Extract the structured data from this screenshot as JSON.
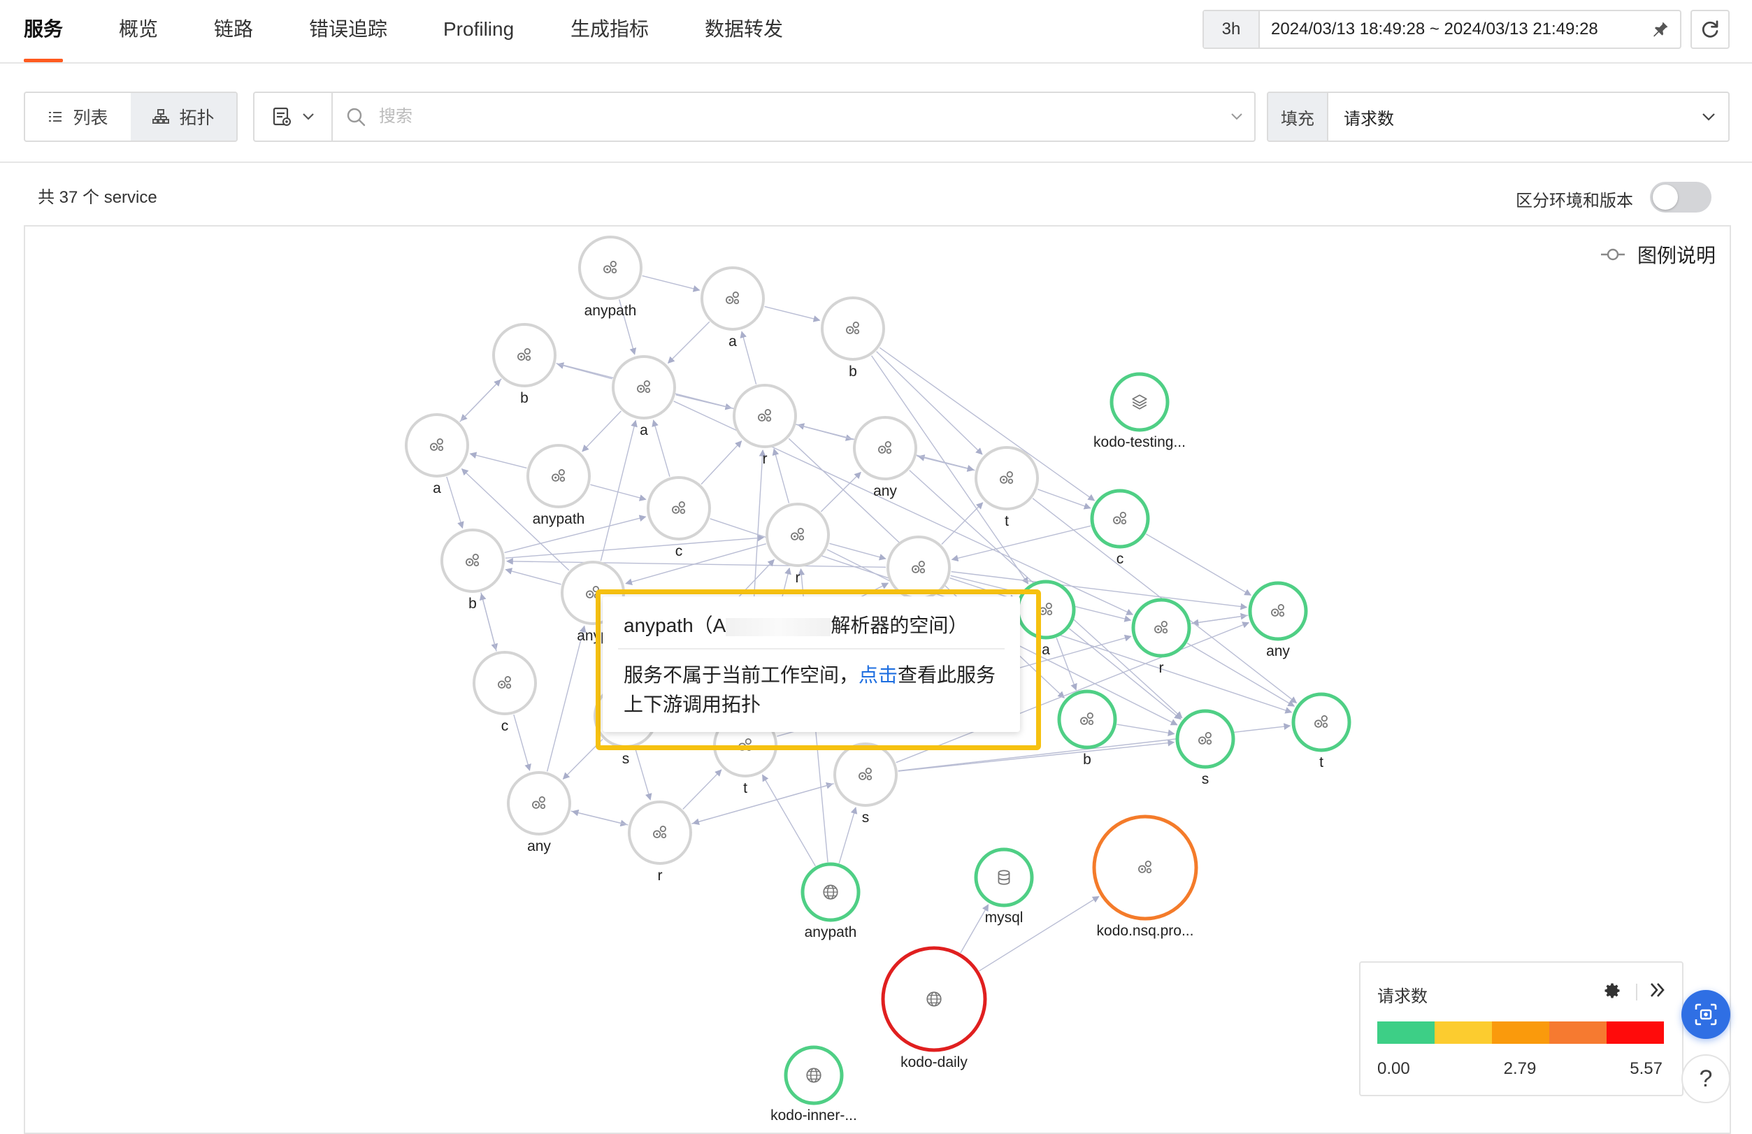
{
  "nav": {
    "tabs": [
      {
        "label": "服务",
        "active": true
      },
      {
        "label": "概览"
      },
      {
        "label": "链路"
      },
      {
        "label": "错误追踪"
      },
      {
        "label": "Profiling"
      },
      {
        "label": "生成指标"
      },
      {
        "label": "数据转发"
      }
    ],
    "time_range_label": "3h",
    "time_range_text": "2024/03/13 18:49:28 ~ 2024/03/13 21:49:28",
    "pin_icon": "pin-icon",
    "refresh_icon": "refresh-icon"
  },
  "toolbar": {
    "view_list_label": "列表",
    "view_topology_label": "拓扑",
    "active_view": "拓扑",
    "search_placeholder": "搜索",
    "fill_label": "填充",
    "fill_value": "请求数"
  },
  "summary": {
    "service_count_text": "共 37 个 service",
    "env_version_label": "区分环境和版本",
    "env_version_enabled": false
  },
  "legend_toggle_label": "图例说明",
  "colors": {
    "normal_stroke": "#d4d4d4",
    "healthy_stroke": "#4fcf85",
    "warning_stroke": "#f47b2a",
    "error_stroke": "#e01f1f",
    "edge": "#b9bdd4",
    "highlight": "#f6c110",
    "link": "#1f6fe0"
  },
  "graph": {
    "nodes": [
      {
        "id": "n1",
        "label": "anypath",
        "icon": "service-icon",
        "status": "normal"
      },
      {
        "id": "n2",
        "label": "a",
        "icon": "service-icon",
        "status": "normal"
      },
      {
        "id": "n3",
        "label": "b",
        "icon": "service-icon",
        "status": "normal"
      },
      {
        "id": "n4",
        "label": "b",
        "icon": "service-icon",
        "status": "normal"
      },
      {
        "id": "n5",
        "label": "a",
        "icon": "service-icon",
        "status": "normal"
      },
      {
        "id": "n6",
        "label": "r",
        "icon": "service-icon",
        "status": "normal"
      },
      {
        "id": "n7",
        "label": "a",
        "icon": "service-icon",
        "status": "normal"
      },
      {
        "id": "n8",
        "label": "anypath",
        "icon": "service-icon",
        "status": "normal"
      },
      {
        "id": "n9",
        "label": "any",
        "icon": "service-icon",
        "status": "normal"
      },
      {
        "id": "n10",
        "label": "t",
        "icon": "service-icon",
        "status": "normal"
      },
      {
        "id": "n11",
        "label": "c",
        "icon": "service-icon",
        "status": "normal"
      },
      {
        "id": "n12",
        "label": "r",
        "icon": "service-icon",
        "status": "normal"
      },
      {
        "id": "n13",
        "label": "b",
        "icon": "service-icon",
        "status": "normal"
      },
      {
        "id": "n14",
        "label": "anyp",
        "icon": "service-icon",
        "status": "normal"
      },
      {
        "id": "n15",
        "label": "",
        "icon": "service-icon",
        "status": "normal"
      },
      {
        "id": "n16",
        "label": "c",
        "icon": "service-icon",
        "status": "normal"
      },
      {
        "id": "n17",
        "label": "s",
        "icon": "service-icon",
        "status": "normal"
      },
      {
        "id": "n18",
        "label": "t",
        "icon": "service-icon",
        "status": "normal"
      },
      {
        "id": "n19",
        "label": "s",
        "icon": "service-icon",
        "status": "normal"
      },
      {
        "id": "n20",
        "label": "any",
        "icon": "service-icon",
        "status": "normal"
      },
      {
        "id": "n21",
        "label": "r",
        "icon": "service-icon",
        "status": "normal"
      },
      {
        "id": "n22",
        "label": "kodo-testing...",
        "icon": "layers-icon",
        "status": "healthy"
      },
      {
        "id": "n23",
        "label": "c",
        "icon": "service-icon",
        "status": "healthy"
      },
      {
        "id": "n24",
        "label": "a",
        "icon": "service-icon",
        "status": "healthy"
      },
      {
        "id": "n25",
        "label": "r",
        "icon": "service-icon",
        "status": "healthy"
      },
      {
        "id": "n26",
        "label": "any",
        "icon": "service-icon",
        "status": "healthy"
      },
      {
        "id": "n27",
        "label": "b",
        "icon": "service-icon",
        "status": "healthy"
      },
      {
        "id": "n28",
        "label": "s",
        "icon": "service-icon",
        "status": "healthy"
      },
      {
        "id": "n29",
        "label": "t",
        "icon": "service-icon",
        "status": "healthy"
      },
      {
        "id": "n30",
        "label": "anypath",
        "icon": "globe-icon",
        "status": "healthy"
      },
      {
        "id": "n31",
        "label": "mysql",
        "icon": "database-icon",
        "status": "healthy"
      },
      {
        "id": "n32",
        "label": "kodo.nsq.pro...",
        "icon": "service-icon",
        "status": "warning"
      },
      {
        "id": "n33",
        "label": "kodo-daily",
        "icon": "globe-icon",
        "status": "error"
      },
      {
        "id": "n34",
        "label": "kodo-inner-...",
        "icon": "globe-icon",
        "status": "healthy"
      }
    ],
    "edges": [
      [
        "n1",
        "n2"
      ],
      [
        "n1",
        "n5"
      ],
      [
        "n2",
        "n3"
      ],
      [
        "n2",
        "n5"
      ],
      [
        "n4",
        "n7"
      ],
      [
        "n7",
        "n4"
      ],
      [
        "n5",
        "n4"
      ],
      [
        "n5",
        "n8"
      ],
      [
        "n5",
        "n6"
      ],
      [
        "n6",
        "n2"
      ],
      [
        "n3",
        "n10"
      ],
      [
        "n3",
        "n23"
      ],
      [
        "n6",
        "n9"
      ],
      [
        "n9",
        "n6"
      ],
      [
        "n9",
        "n10"
      ],
      [
        "n10",
        "n9"
      ],
      [
        "n10",
        "n23"
      ],
      [
        "n7",
        "n13"
      ],
      [
        "n8",
        "n7"
      ],
      [
        "n8",
        "n11"
      ],
      [
        "n11",
        "n5"
      ],
      [
        "n11",
        "n6"
      ],
      [
        "n12",
        "n6"
      ],
      [
        "n12",
        "n9"
      ],
      [
        "n12",
        "n15"
      ],
      [
        "n12",
        "n14"
      ],
      [
        "n13",
        "n16"
      ],
      [
        "n13",
        "n12"
      ],
      [
        "n13",
        "n11"
      ],
      [
        "n14",
        "n13"
      ],
      [
        "n14",
        "n7"
      ],
      [
        "n14",
        "n5"
      ],
      [
        "n15",
        "n13"
      ],
      [
        "n15",
        "n10"
      ],
      [
        "n15",
        "n24"
      ],
      [
        "n15",
        "n25"
      ],
      [
        "n16",
        "n20"
      ],
      [
        "n20",
        "n21"
      ],
      [
        "n21",
        "n20"
      ],
      [
        "n20",
        "n14"
      ],
      [
        "n21",
        "n18"
      ],
      [
        "n21",
        "n19"
      ],
      [
        "n19",
        "n21"
      ],
      [
        "n19",
        "n28"
      ],
      [
        "n19",
        "n29"
      ],
      [
        "n18",
        "n12"
      ],
      [
        "n18",
        "n6"
      ],
      [
        "n30",
        "n18"
      ],
      [
        "n30",
        "n19"
      ],
      [
        "n30",
        "n12"
      ],
      [
        "n17",
        "n21"
      ],
      [
        "n17",
        "n20"
      ],
      [
        "n17",
        "n12"
      ],
      [
        "n23",
        "n15"
      ],
      [
        "n23",
        "n26"
      ],
      [
        "n25",
        "n29"
      ],
      [
        "n25",
        "n26"
      ],
      [
        "n26",
        "n25"
      ],
      [
        "n27",
        "n28"
      ],
      [
        "n24",
        "n28"
      ],
      [
        "n24",
        "n27"
      ],
      [
        "n10",
        "n29"
      ],
      [
        "n9",
        "n28"
      ],
      [
        "n6",
        "n27"
      ],
      [
        "n4",
        "n10"
      ],
      [
        "n3",
        "n24"
      ],
      [
        "n5",
        "n25"
      ],
      [
        "n16",
        "n13"
      ],
      [
        "n18",
        "n25"
      ],
      [
        "n19",
        "n26"
      ],
      [
        "n12",
        "n28"
      ],
      [
        "n15",
        "n26"
      ],
      [
        "n11",
        "n29"
      ],
      [
        "n33",
        "n31"
      ],
      [
        "n33",
        "n32"
      ],
      [
        "n17",
        "n15"
      ]
    ]
  },
  "tooltip": {
    "title_prefix": "anypath（A",
    "title_suffix": "解析器的空间）",
    "body_before_link": "服务不属于当前工作空间，",
    "link_text": "点击",
    "body_after_link": "查看此服务上下游调用拓扑"
  },
  "scale": {
    "title": "请求数",
    "min": "0.00",
    "mid": "2.79",
    "max": "5.57",
    "colors": [
      "#3dcf86",
      "#fccc2f",
      "#fa9a0c",
      "#f67a30",
      "#ff0b0b"
    ]
  },
  "help_label": "?"
}
